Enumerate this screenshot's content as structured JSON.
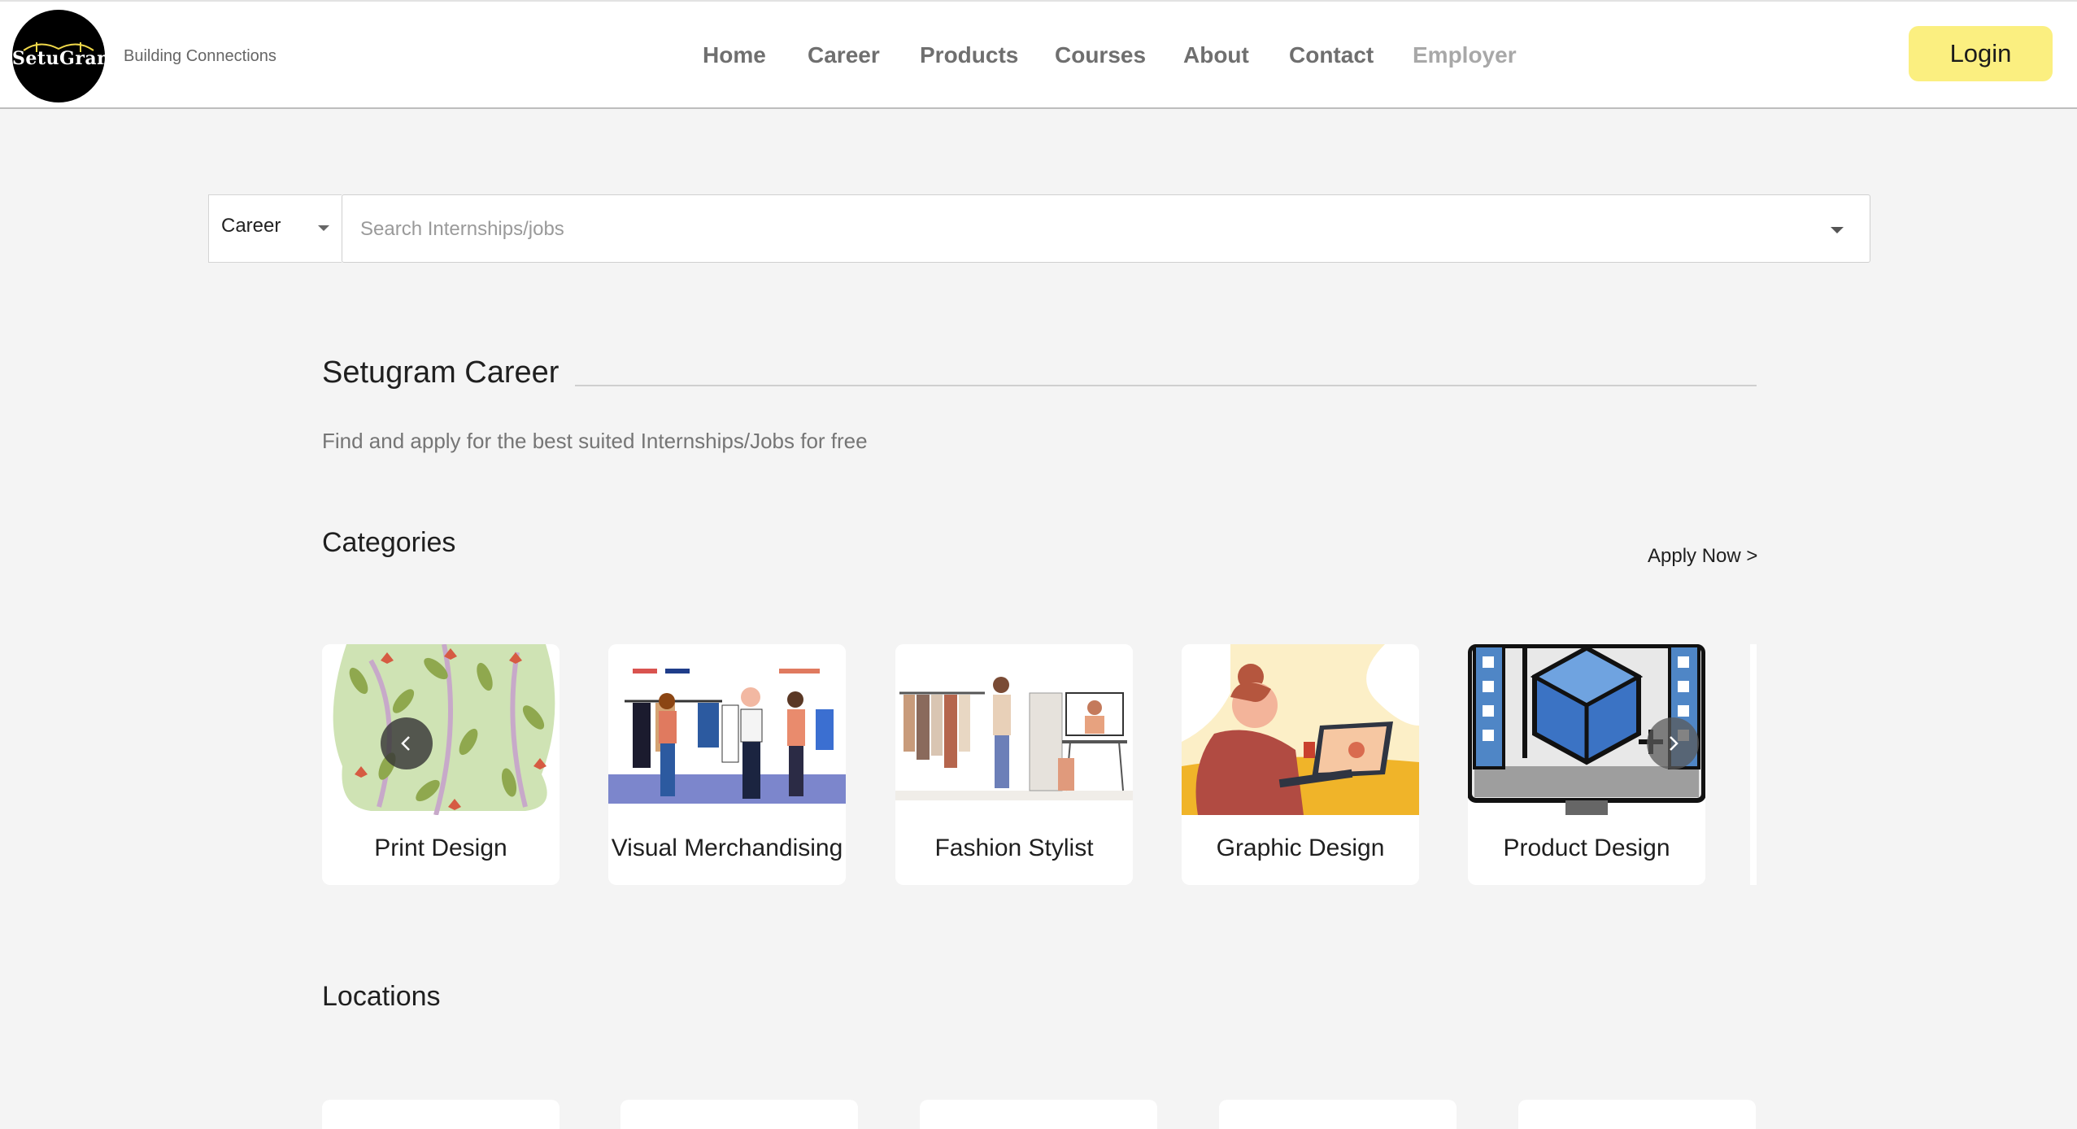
{
  "header": {
    "logo_text": "SetuGram",
    "tagline": "Building Connections",
    "nav": [
      {
        "label": "Home"
      },
      {
        "label": "Career"
      },
      {
        "label": "Products"
      },
      {
        "label": "Courses"
      },
      {
        "label": "About"
      },
      {
        "label": "Contact"
      },
      {
        "label": "Employer"
      }
    ],
    "login_label": "Login",
    "login_color": "#fbef80"
  },
  "search": {
    "category_value": "Career",
    "placeholder": "Search Internships/jobs"
  },
  "main": {
    "title": "Setugram Career",
    "subtitle": "Find and apply for the best suited Internships/Jobs for free",
    "categories_heading": "Categories",
    "apply_link": "Apply Now >",
    "categories": [
      {
        "label": "Print Design",
        "icon": "leaf-pattern-illustration"
      },
      {
        "label": "Visual Merchandising",
        "icon": "clothing-store-illustration"
      },
      {
        "label": "Fashion Stylist",
        "icon": "stylist-studio-illustration"
      },
      {
        "label": "Graphic Design",
        "icon": "designer-laptop-illustration"
      },
      {
        "label": "Product Design",
        "icon": "3d-cube-monitor-illustration"
      }
    ],
    "locations_heading": "Locations",
    "carousel": {
      "prev_icon": "chevron-left-icon",
      "next_icon": "chevron-right-icon"
    }
  }
}
